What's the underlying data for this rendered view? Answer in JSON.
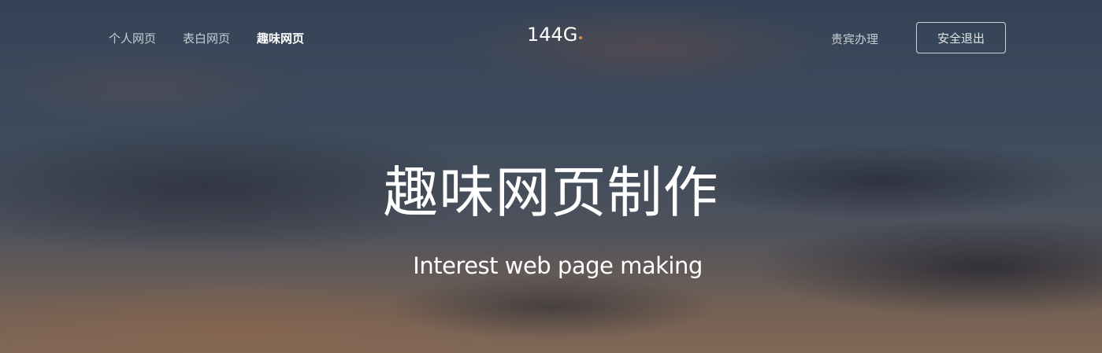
{
  "nav": {
    "links": [
      {
        "label": "个人网页",
        "active": false
      },
      {
        "label": "表白网页",
        "active": false
      },
      {
        "label": "趣味网页",
        "active": true
      }
    ],
    "logo": "144G",
    "vip_label": "贵宾办理",
    "logout_label": "安全退出"
  },
  "hero": {
    "title": "趣味网页制作",
    "subtitle": "Interest web page making"
  }
}
